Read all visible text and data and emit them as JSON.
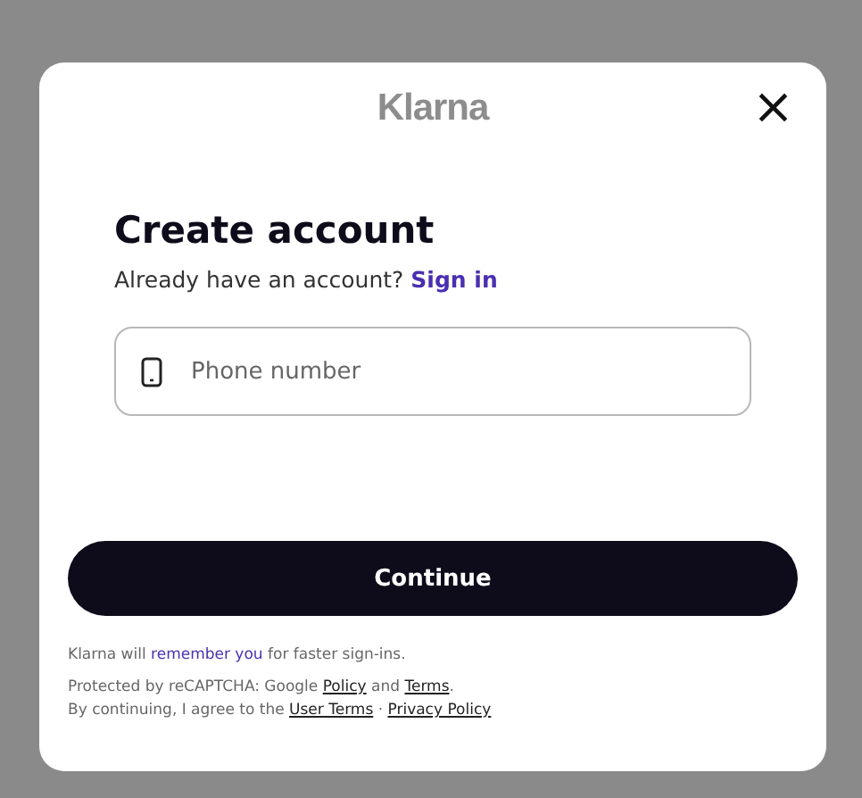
{
  "dialog": {
    "logo": "Klarna",
    "close": "×"
  },
  "heading": "Create account",
  "subtitle": {
    "text": "Already have an account?",
    "link": "Sign in"
  },
  "phone_field": {
    "placeholder": "Phone number"
  },
  "primary_button": "Continue",
  "notes": [
    [
      {
        "kind": "text",
        "text": "Klarna will "
      },
      {
        "kind": "accent",
        "text": "remember you"
      },
      {
        "kind": "text",
        "text": " for faster sign-ins."
      }
    ],
    [
      {
        "kind": "text",
        "text": "Protected by reCAPTCHA: Google "
      },
      {
        "kind": "link",
        "text": "Policy"
      },
      {
        "kind": "text",
        "text": " and "
      },
      {
        "kind": "link",
        "text": "Terms"
      },
      {
        "kind": "text",
        "text": "."
      }
    ],
    [
      {
        "kind": "text",
        "text": "By continuing, I agree to the "
      },
      {
        "kind": "link",
        "text": "User Terms"
      },
      {
        "kind": "text",
        "text": " · "
      },
      {
        "kind": "link",
        "text": "Privacy Policy"
      }
    ]
  ]
}
